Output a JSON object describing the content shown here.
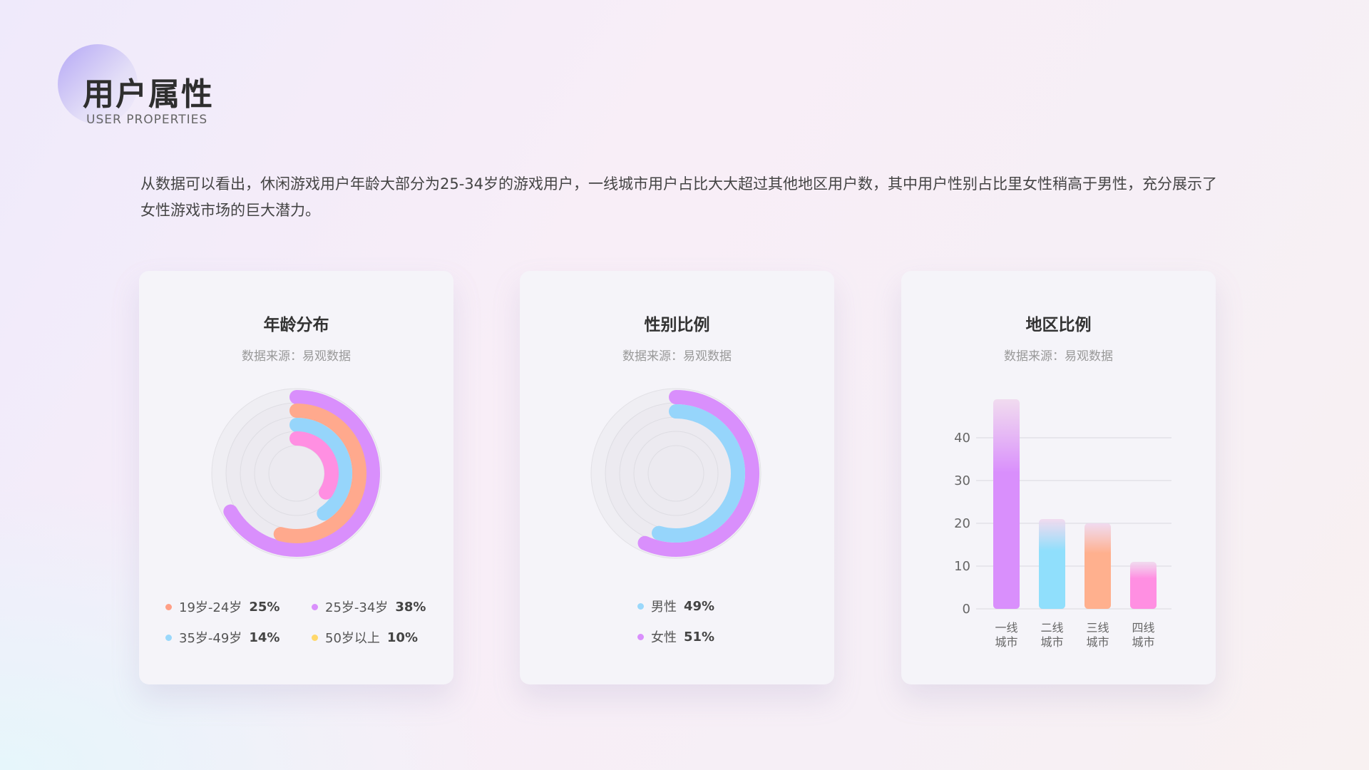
{
  "header": {
    "title": "用户属性",
    "subtitle": "USER PROPERTIES"
  },
  "description": "从数据可以看出，休闲游戏用户年龄大部分为25-34岁的游戏用户，一线城市用户占比大大超过其他地区用户数，其中用户性别占比里女性稍高于男性，充分展示了女性游戏市场的巨大潜力。",
  "chart_data": [
    {
      "type": "radial-bar",
      "title": "年龄分布",
      "subtitle": "数据来源：易观数据",
      "series": [
        {
          "name": "19岁-24岁",
          "value": 25,
          "label": "25%",
          "color": "#ffa98d",
          "dot": "#ff9f86"
        },
        {
          "name": "25岁-34岁",
          "value": 38,
          "label": "38%",
          "color": "#d98ffc",
          "dot": "#d98ffc"
        },
        {
          "name": "35岁-49岁",
          "value": 14,
          "label": "14%",
          "color": "#96d5fb",
          "dot": "#9ad8fb"
        },
        {
          "name": "50岁以上",
          "value": 10,
          "label": "10%",
          "color": "#ff8fe2",
          "dot": "#ffd86b"
        }
      ]
    },
    {
      "type": "radial-bar",
      "title": "性别比例",
      "subtitle": "数据来源：易观数据",
      "series": [
        {
          "name": "男性",
          "value": 49,
          "label": "49%",
          "color": "#96d5fb",
          "dot": "#9ad8fb"
        },
        {
          "name": "女性",
          "value": 51,
          "label": "51%",
          "color": "#d98ffc",
          "dot": "#d98ffc"
        }
      ]
    },
    {
      "type": "bar",
      "title": "地区比例",
      "subtitle": "数据来源：易观数据",
      "categories": [
        [
          "一线",
          "城市"
        ],
        [
          "二线",
          "城市"
        ],
        [
          "三线",
          "城市"
        ],
        [
          "四线",
          "城市"
        ]
      ],
      "values": [
        49,
        21,
        20,
        11
      ],
      "colors": [
        "#d98ffc",
        "#90dffc",
        "#ffb08e",
        "#ff8fe2"
      ],
      "ylim": [
        0,
        40
      ],
      "yticks": [
        0,
        10,
        20,
        30,
        40
      ],
      "grid": true
    }
  ]
}
